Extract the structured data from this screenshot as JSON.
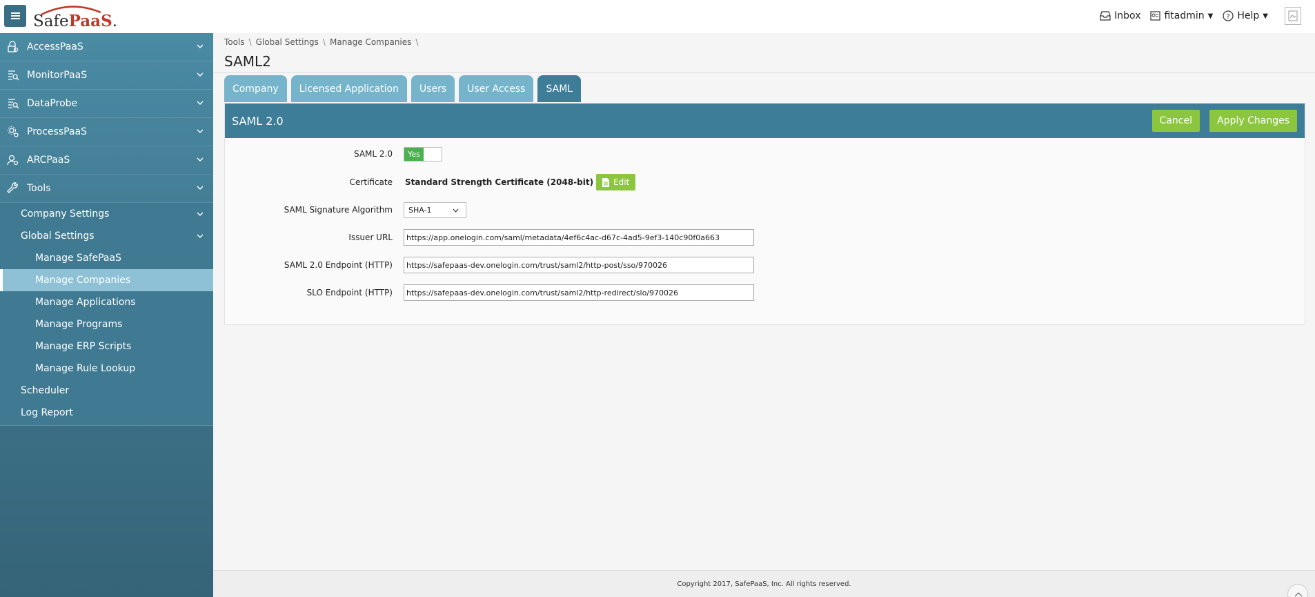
{
  "header": {
    "logo": {
      "text_a": "Safe",
      "text_b": "PaaS",
      "mark": "."
    },
    "inbox": "Inbox",
    "user": "fitadmin",
    "help": "Help"
  },
  "sidebar": {
    "top_items": [
      {
        "label": "AccessPaaS",
        "icon": "lock-search-icon"
      },
      {
        "label": "MonitorPaaS",
        "icon": "monitor-search-icon"
      },
      {
        "label": "DataProbe",
        "icon": "data-probe-icon"
      },
      {
        "label": "ProcessPaaS",
        "icon": "gears-icon"
      },
      {
        "label": "ARCPaaS",
        "icon": "user-search-icon"
      },
      {
        "label": "Tools",
        "icon": "wrench-icon"
      }
    ],
    "tools_sub": {
      "company_settings": "Company Settings",
      "global_settings": "Global Settings",
      "global_children": [
        "Manage SafePaaS",
        "Manage Companies",
        "Manage Applications",
        "Manage Programs",
        "Manage ERP Scripts",
        "Manage Rule Lookup"
      ],
      "scheduler": "Scheduler",
      "log_report": "Log Report"
    }
  },
  "breadcrumb": [
    "Tools",
    "Global Settings",
    "Manage Companies"
  ],
  "page_title": "SAML2",
  "tabs": [
    "Company",
    "Licensed Application",
    "Users",
    "User Access",
    "SAML"
  ],
  "panel": {
    "title": "SAML 2.0",
    "cancel": "Cancel",
    "apply": "Apply Changes"
  },
  "form": {
    "saml_label": "SAML 2.0",
    "saml_toggle": "Yes",
    "cert_label": "Certificate",
    "cert_value": "Standard Strength Certificate (2048-bit)",
    "cert_edit": "Edit",
    "algo_label": "SAML Signature Algorithm",
    "algo_value": "SHA-1",
    "issuer_label": "Issuer URL",
    "issuer_value": "https://app.onelogin.com/saml/metadata/4ef6c4ac-d67c-4ad5-9ef3-140c90f0a663",
    "endpoint_label": "SAML 2.0 Endpoint (HTTP)",
    "endpoint_value": "https://safepaas-dev.onelogin.com/trust/saml2/http-post/sso/970026",
    "slo_label": "SLO Endpoint (HTTP)",
    "slo_value": "https://safepaas-dev.onelogin.com/trust/saml2/http-redirect/slo/970026"
  },
  "footer": "Copyright 2017, SafePaaS, Inc. All rights reserved.",
  "colors": {
    "primary": "#3d7d97",
    "tab": "#75b4ca",
    "green": "#8cc63f",
    "active_nav": "#8ec1d5"
  }
}
